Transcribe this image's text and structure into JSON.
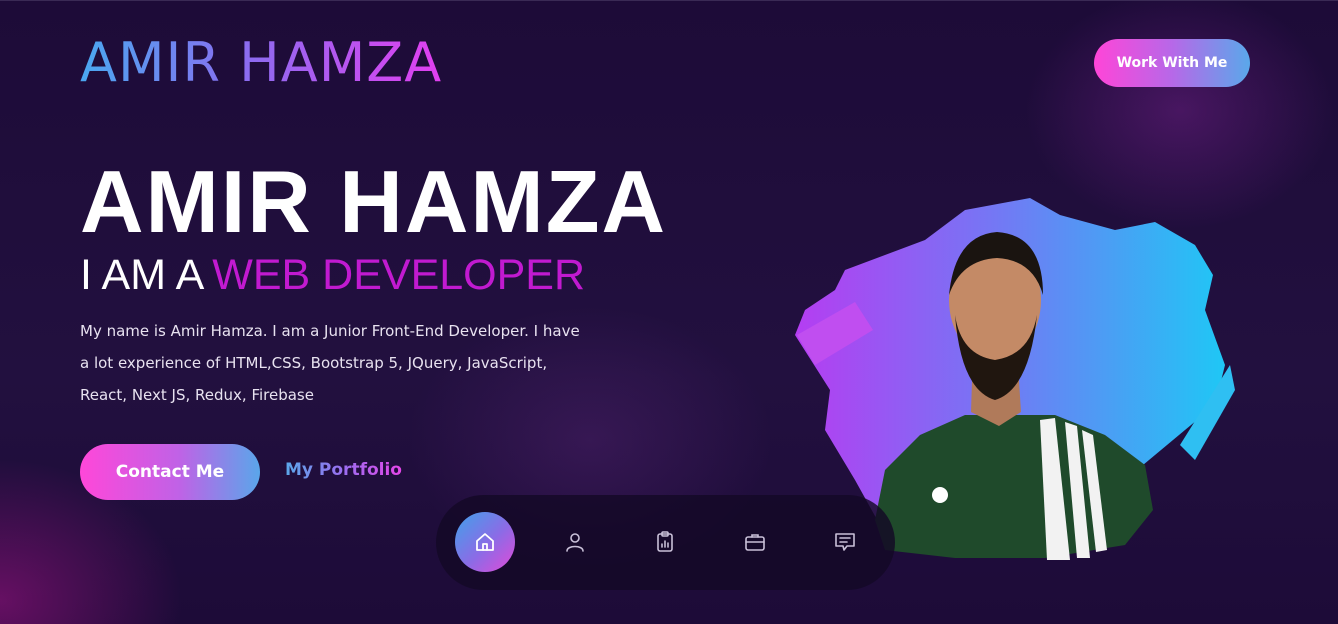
{
  "brand": {
    "logo_text": "AMIR HAMZA",
    "logo_gradient": [
      "#4aa8f0",
      "#8a6df0",
      "#e23ff0"
    ]
  },
  "header": {
    "cta_label": "Work With Me"
  },
  "hero": {
    "name": "AMIR HAMZA",
    "subtitle_prefix": "I AM A",
    "subtitle_role": "WEB DEVELOPER",
    "role_color": "#c11ad0",
    "description": "My name is Amir Hamza. I am a Junior Front-End Developer. I have a lot experience of HTML,CSS, Bootstrap 5, JQuery, JavaScript, React, Next JS, Redux, Firebase",
    "primary_button": "Contact Me",
    "secondary_link": "My Portfolio"
  },
  "bottom_nav": {
    "active_index": 0,
    "items": [
      {
        "icon": "home-icon"
      },
      {
        "icon": "user-icon"
      },
      {
        "icon": "clipboard-chart-icon"
      },
      {
        "icon": "briefcase-icon"
      },
      {
        "icon": "message-icon"
      }
    ]
  },
  "colors": {
    "background": "#1e0d3b",
    "accent_pink": "#ff45d8",
    "accent_blue": "#5aa8ea",
    "accent_purple": "#8c6be6"
  }
}
